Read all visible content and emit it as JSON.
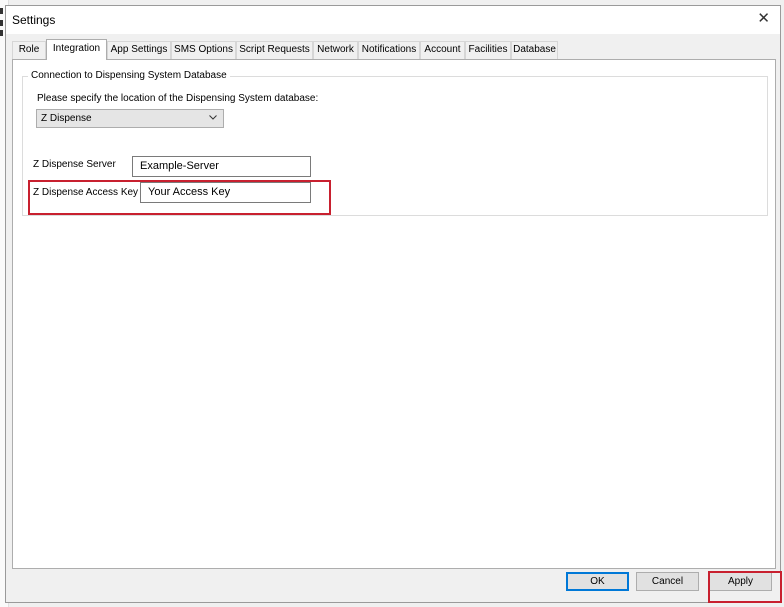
{
  "window": {
    "title": "Settings",
    "close_glyph": "✕"
  },
  "tabs": [
    {
      "label": "Role",
      "active": false
    },
    {
      "label": "Integration",
      "active": true
    },
    {
      "label": "App Settings",
      "active": false
    },
    {
      "label": "SMS Options",
      "active": false
    },
    {
      "label": "Script Requests",
      "active": false
    },
    {
      "label": "Network",
      "active": false
    },
    {
      "label": "Notifications",
      "active": false
    },
    {
      "label": "Account",
      "active": false
    },
    {
      "label": "Facilities",
      "active": false
    },
    {
      "label": "Database",
      "active": false
    }
  ],
  "integration": {
    "group_title": "Connection to Dispensing System Database",
    "prompt": "Please specify the location of the Dispensing System database:",
    "dispensing_system": "Z Dispense",
    "server_label": "Z Dispense Server",
    "server_value": "Example-Server",
    "access_key_label": "Z Dispense Access Key",
    "access_key_value": "Your Access Key"
  },
  "buttons": {
    "ok": "OK",
    "cancel": "Cancel",
    "apply": "Apply"
  },
  "colors": {
    "highlight": "#c8202f",
    "default_button_border": "#0078d7"
  }
}
